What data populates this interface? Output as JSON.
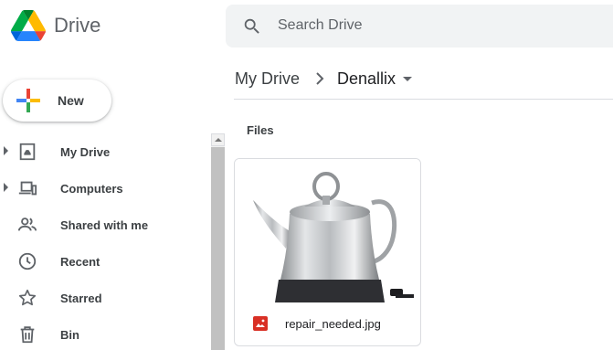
{
  "app": {
    "title": "Drive",
    "logo_icon": "google-drive-logo"
  },
  "search": {
    "placeholder": "Search Drive",
    "icon": "search-icon"
  },
  "new_button": {
    "label": "New",
    "icon": "multicolor-plus-icon"
  },
  "sidebar": {
    "items": [
      {
        "label": "My Drive",
        "icon": "my-drive-icon",
        "expandable": true
      },
      {
        "label": "Computers",
        "icon": "computers-icon",
        "expandable": true
      },
      {
        "label": "Shared with me",
        "icon": "shared-icon",
        "expandable": false
      },
      {
        "label": "Recent",
        "icon": "clock-icon",
        "expandable": false
      },
      {
        "label": "Starred",
        "icon": "star-icon",
        "expandable": false
      },
      {
        "label": "Bin",
        "icon": "trash-icon",
        "expandable": false
      }
    ]
  },
  "breadcrumb": {
    "root": "My Drive",
    "current": "Denallix"
  },
  "main": {
    "section_title": "Files",
    "files": [
      {
        "name": "repair_needed.jpg",
        "type_icon": "image-file-icon",
        "thumbnail": "kettle"
      }
    ]
  },
  "colors": {
    "accent_red": "#d93025",
    "text": "#3c4043",
    "border": "#dadce0",
    "search_bg": "#f1f3f4"
  }
}
